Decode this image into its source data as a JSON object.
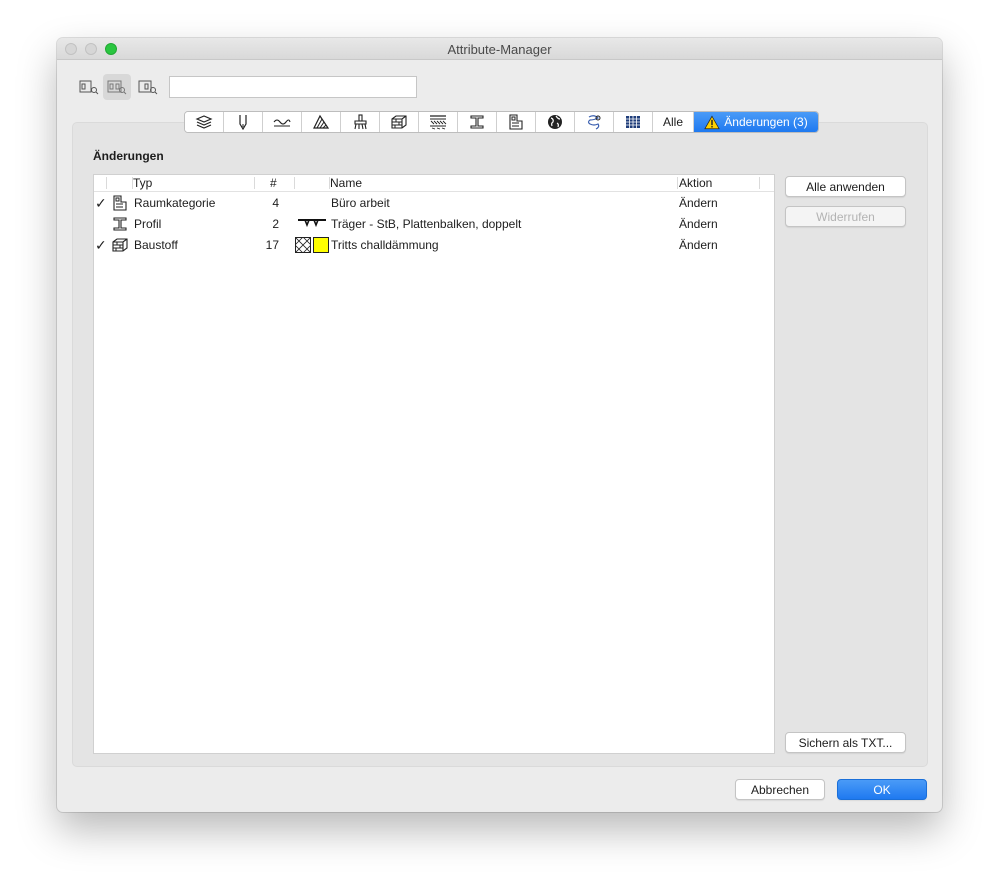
{
  "window": {
    "title": "Attribute-Manager"
  },
  "toolbar": {
    "view_buttons": [
      "view-left-icon",
      "view-both-icon",
      "view-right-icon"
    ],
    "search_value": ""
  },
  "tabs": {
    "icons": [
      "layers-icon",
      "pen-icon",
      "line-type-icon",
      "fill-icon",
      "surface-icon",
      "building-material-icon",
      "composite-icon",
      "profile-icon",
      "zone-category-icon",
      "globe-icon",
      "mep-icon",
      "grid-table-icon"
    ],
    "all_label": "Alle",
    "changes_label": "Änderungen (3)",
    "changes_icon": "warning-icon"
  },
  "section": {
    "title": "Änderungen"
  },
  "table": {
    "headers": {
      "typ": "Typ",
      "num": "#",
      "name": "Name",
      "aktion": "Aktion"
    },
    "rows": [
      {
        "checked": true,
        "type_icon": "zone-category-icon",
        "typ": "Raumkategorie",
        "num": "4",
        "preview": "",
        "name": "Büro arbeit",
        "aktion": "Ändern"
      },
      {
        "checked": false,
        "type_icon": "profile-icon",
        "typ": "Profil",
        "num": "2",
        "preview": "beam-profile-preview",
        "name": "Träger -   StB, Plattenbalken, doppelt",
        "aktion": "Ändern"
      },
      {
        "checked": true,
        "type_icon": "building-material-icon",
        "typ": "Baustoff",
        "num": "17",
        "preview": "hatch-swatch",
        "swatch_color": "#ffff00",
        "name": "Tritts challdämmung",
        "aktion": "Ändern"
      }
    ]
  },
  "side_buttons": {
    "apply_all": "Alle anwenden",
    "undo": "Widerrufen",
    "save_txt": "Sichern als TXT..."
  },
  "footer": {
    "cancel": "Abbrechen",
    "ok": "OK"
  },
  "colors": {
    "accent": "#1f79f0",
    "check_mark": "#1d1d1d"
  }
}
